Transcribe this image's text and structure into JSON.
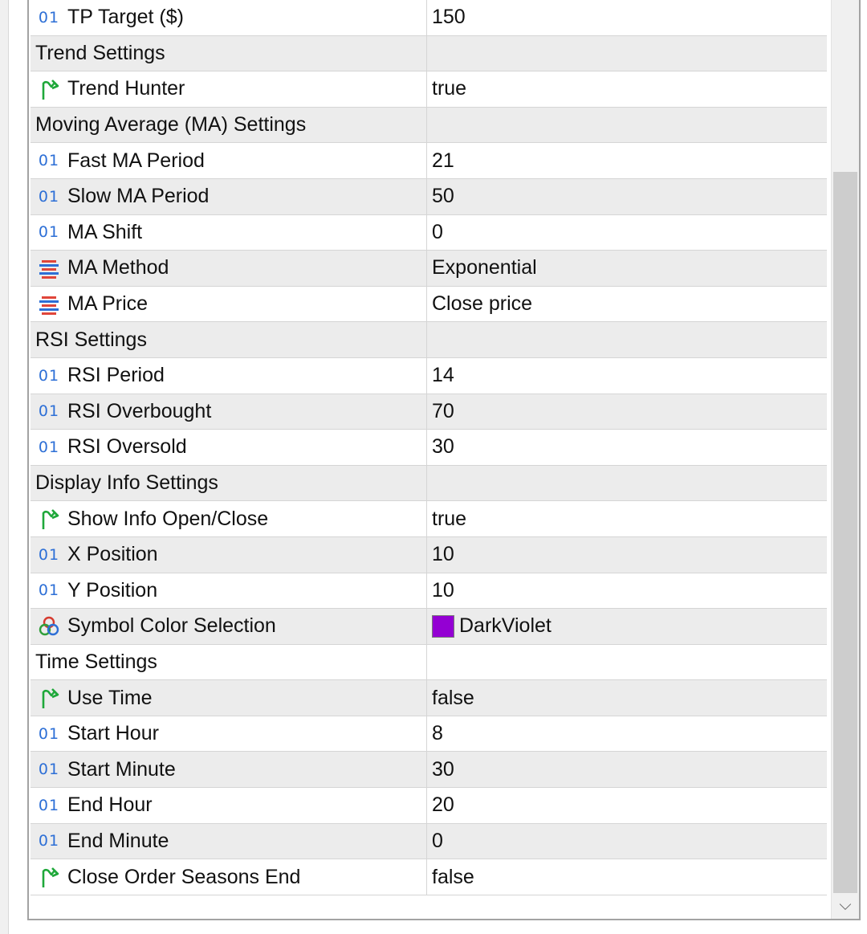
{
  "rows": [
    {
      "kind": "param",
      "type": "int",
      "name": "TP Target ($)",
      "value": "150"
    },
    {
      "kind": "group",
      "name": "Trend Settings",
      "value": ""
    },
    {
      "kind": "param",
      "type": "bool",
      "name": "Trend Hunter",
      "value": "true"
    },
    {
      "kind": "group",
      "name": "Moving Average (MA) Settings",
      "value": ""
    },
    {
      "kind": "param",
      "type": "int",
      "name": "Fast MA Period",
      "value": "21"
    },
    {
      "kind": "param",
      "type": "int",
      "name": "Slow MA Period",
      "value": "50"
    },
    {
      "kind": "param",
      "type": "int",
      "name": "MA Shift",
      "value": "0"
    },
    {
      "kind": "param",
      "type": "enum",
      "name": "MA Method",
      "value": "Exponential"
    },
    {
      "kind": "param",
      "type": "enum",
      "name": "MA Price",
      "value": "Close price"
    },
    {
      "kind": "group",
      "name": "RSI Settings",
      "value": ""
    },
    {
      "kind": "param",
      "type": "int",
      "name": "RSI Period",
      "value": "14"
    },
    {
      "kind": "param",
      "type": "int",
      "name": "RSI Overbought",
      "value": "70"
    },
    {
      "kind": "param",
      "type": "int",
      "name": "RSI Oversold",
      "value": "30"
    },
    {
      "kind": "group",
      "name": "Display Info Settings",
      "value": ""
    },
    {
      "kind": "param",
      "type": "bool",
      "name": "Show Info Open/Close",
      "value": "true"
    },
    {
      "kind": "param",
      "type": "int",
      "name": "X Position",
      "value": "10"
    },
    {
      "kind": "param",
      "type": "int",
      "name": "Y Position",
      "value": "10"
    },
    {
      "kind": "param",
      "type": "color",
      "name": "Symbol Color Selection",
      "value": "DarkViolet",
      "swatch": "#9400D3"
    },
    {
      "kind": "group",
      "name": "Time Settings",
      "value": ""
    },
    {
      "kind": "param",
      "type": "bool",
      "name": "Use Time",
      "value": "false"
    },
    {
      "kind": "param",
      "type": "int",
      "name": "Start Hour",
      "value": "8"
    },
    {
      "kind": "param",
      "type": "int",
      "name": "Start Minute",
      "value": "30"
    },
    {
      "kind": "param",
      "type": "int",
      "name": "End Hour",
      "value": "20"
    },
    {
      "kind": "param",
      "type": "int",
      "name": "End Minute",
      "value": "0"
    },
    {
      "kind": "param",
      "type": "bool",
      "name": "Close Order Seasons End",
      "value": "false"
    }
  ],
  "icons": {
    "int": "int-parameter-icon",
    "bool": "bool-parameter-icon",
    "enum": "enum-parameter-icon",
    "color": "color-parameter-icon"
  },
  "colors": {
    "int_icon": "#2D6FD6",
    "bool_icon": "#1FA83A",
    "enum_icon_red": "#E0463A",
    "enum_icon_blue": "#2D6FD6",
    "row_alt": "#ECECEC",
    "grid": "#D5D5D5"
  },
  "int_icon_glyph": "01"
}
